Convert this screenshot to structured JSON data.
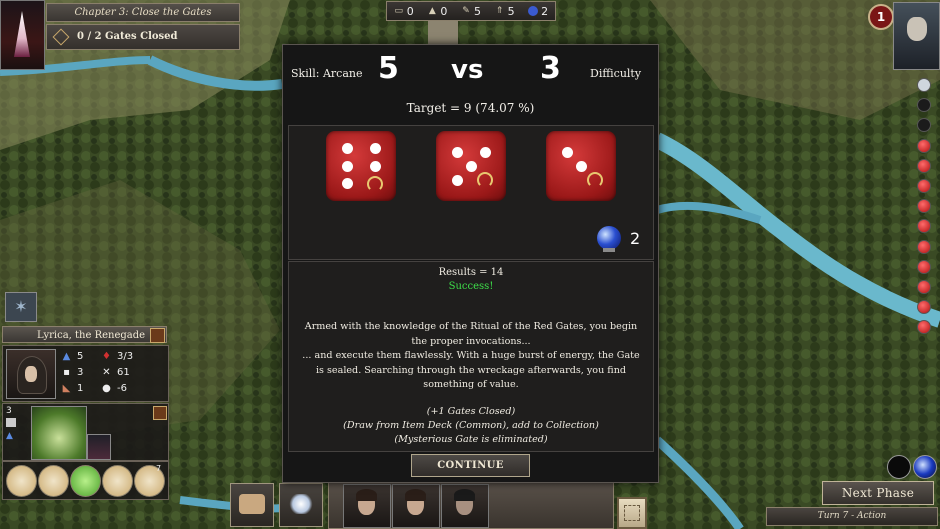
{
  "objective": {
    "chapter_title": "Chapter 3: Close the Gates",
    "gates_progress": "0 / 2 Gates Closed"
  },
  "resources": [
    {
      "icon": "book-icon",
      "value": "0"
    },
    {
      "icon": "bell-icon",
      "value": "0"
    },
    {
      "icon": "feather-icon",
      "value": "5"
    },
    {
      "icon": "arrows-icon",
      "value": "5"
    },
    {
      "icon": "orb-icon",
      "value": "2"
    }
  ],
  "doom": {
    "badge": "1"
  },
  "skill_check": {
    "skill_label": "Skill: Arcane",
    "skill_value": "5",
    "vs_label": "vs",
    "difficulty_value": "3",
    "difficulty_label": "Difficulty",
    "target_text": "Target = 9  (74.07 %)",
    "dice": [
      6,
      5,
      3
    ],
    "clue_count": "2",
    "results_text": "Results = 14",
    "success_text": "Success!",
    "story_lines": [
      "Armed with the knowledge of the Ritual of the Red Gates, you begin the proper invocations...",
      "... and execute them flawlessly.  With a huge burst of energy, the Gate is sealed.  Searching through the wreckage afterwards, you find something of value."
    ],
    "effect_lines": [
      "(+1 Gates Closed)",
      "(Draw from Item Deck (Common), add to Collection)",
      "(Mysterious Gate is eliminated)"
    ],
    "continue_label": "CONTINUE"
  },
  "character": {
    "name": "Lyrica, the Renegade",
    "stats": [
      {
        "icon": "arcane-icon",
        "value": "5"
      },
      {
        "icon": "health-icon",
        "value": "3/3"
      },
      {
        "icon": "speech-icon",
        "value": "3"
      },
      {
        "icon": "swords-icon",
        "value": "61"
      },
      {
        "icon": "strength-icon",
        "value": "1"
      },
      {
        "icon": "sanity-icon",
        "value": "-6"
      }
    ],
    "asset_count": "3",
    "item_count": "7"
  },
  "controls": {
    "next_phase_label": "Next Phase",
    "turn_label": "Turn 7 - Action"
  },
  "colors": {
    "success_green": "#3ee04a",
    "dice_red": "#b82020",
    "panel_dark": "#161616"
  }
}
